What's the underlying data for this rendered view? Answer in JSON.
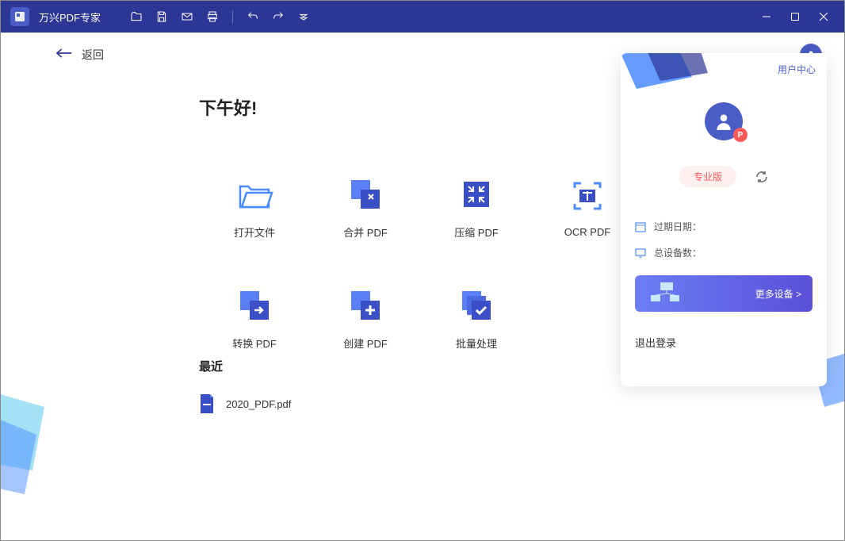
{
  "app": {
    "title": "万兴PDF专家"
  },
  "nav": {
    "back": "返回"
  },
  "greeting": "下午好!",
  "actions": [
    {
      "label": "打开文件"
    },
    {
      "label": "合并 PDF"
    },
    {
      "label": "压缩 PDF"
    },
    {
      "label": "OCR PDF"
    },
    {
      "label": "转换 PDF"
    },
    {
      "label": "创建 PDF"
    },
    {
      "label": "批量处理"
    }
  ],
  "recent": {
    "title": "最近",
    "items": [
      {
        "name": "2020_PDF.pdf"
      }
    ]
  },
  "user_panel": {
    "header_link": "用户中心",
    "avatar_badge": "P",
    "pro_label": "专业版",
    "expiry_label": "过期日期：",
    "devices_label": "总设备数：",
    "more_devices": "更多设备 >",
    "logout": "退出登录"
  },
  "colors": {
    "primary": "#2c3694",
    "accent": "#4a5cc5",
    "danger": "#ff5a5a"
  }
}
